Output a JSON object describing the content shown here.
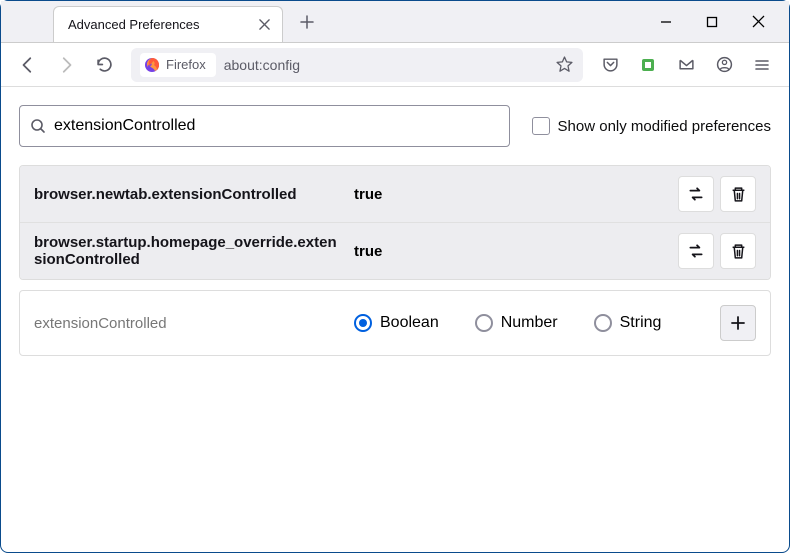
{
  "titlebar": {
    "tab_title": "Advanced Preferences"
  },
  "toolbar": {
    "identity_label": "Firefox",
    "url": "about:config"
  },
  "search": {
    "value": "extensionControlled",
    "modified_only_label": "Show only modified preferences"
  },
  "prefs": [
    {
      "name": "browser.newtab.extensionControlled",
      "value": "true"
    },
    {
      "name": "browser.startup.homepage_override.extensionControlled",
      "value": "true"
    }
  ],
  "newpref": {
    "name": "extensionControlled",
    "types": {
      "boolean": "Boolean",
      "number": "Number",
      "string": "String"
    }
  }
}
